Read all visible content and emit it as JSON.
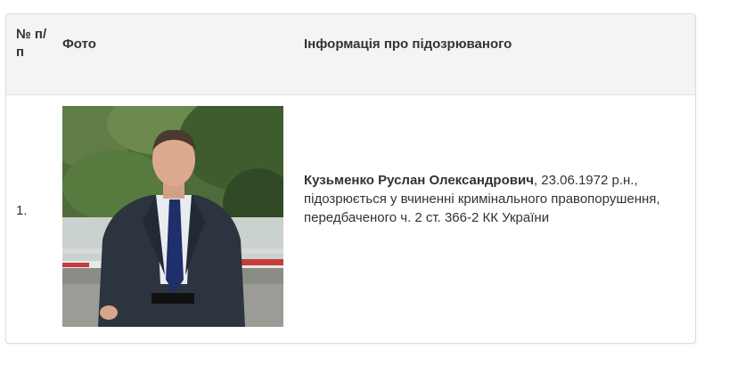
{
  "table": {
    "headers": {
      "number": "№ п/п",
      "photo": "Фото",
      "info": "Інформація про підозрюваного"
    },
    "rows": [
      {
        "number": "1.",
        "name": "Кузьменко Руслан Олександрович",
        "details": ", 23.06.1972 р.н., підозрюється у вчиненні кримінального правопорушення, передбаченого ч. 2 ст. 366-2 КК України"
      }
    ]
  }
}
